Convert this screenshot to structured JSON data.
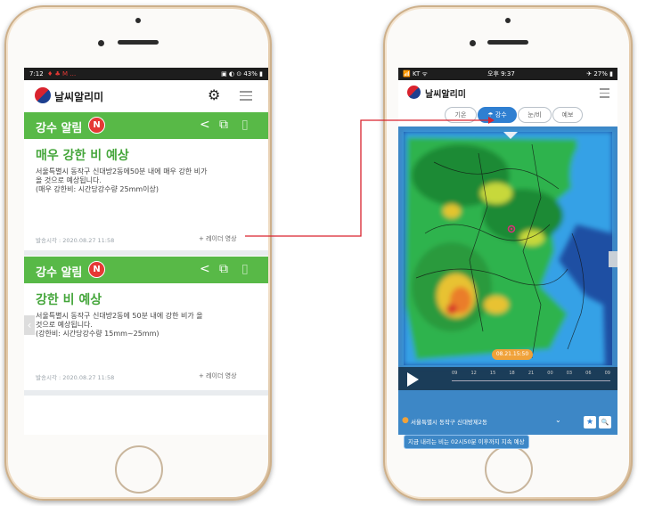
{
  "left_phone": {
    "status": {
      "time": "7:12",
      "icons": "♦ ♣ M …",
      "right": "▣ ◐ ⊙ 43% ▮"
    },
    "header": {
      "app_name": "날씨알리미",
      "gear_icon": "gear-icon",
      "menu_icon": "menu-icon"
    },
    "cards": [
      {
        "tag": "강수 알림",
        "badge": "N",
        "headline": "매우 강한 비 예상",
        "body": [
          "서울특별시 동작구 신대방2동에50분 내에 매우 강한 비가",
          "올 것으로 예상됩니다.",
          "(매우 강한비: 시간당강수량 25mm이상)"
        ],
        "time": "발송시각 : 2020.08.27 11:58",
        "link": "+ 레이더 영상"
      },
      {
        "tag": "강수 알림",
        "badge": "N",
        "headline": "강한 비 예상",
        "body": [
          "서울특별시 동작구 신대방2동에 50분 내에 강한 비가 올",
          "것으로 예상됩니다.",
          "(강한비: 시간당강수량 15mm~25mm)"
        ],
        "time": "발송시각 : 2020.08.27 11:58",
        "link": "+ 레이더 영상"
      }
    ]
  },
  "right_phone": {
    "status": {
      "carrier": "📶 KT ᯤ",
      "time": "오후 9:37",
      "battery": "✈ 27% ▮"
    },
    "header": {
      "app_name": "날씨알리미"
    },
    "tabs": [
      {
        "label": "기온",
        "active": false
      },
      {
        "label": "☂ 강수",
        "active": true
      },
      {
        "label": "눈/비",
        "active": false
      },
      {
        "label": "예보",
        "active": false
      }
    ],
    "radar": {
      "timestamp": "08.21.15:50",
      "ticks": [
        "09",
        "12",
        "15",
        "18",
        "21",
        "00",
        "03",
        "06",
        "09"
      ]
    },
    "location": {
      "text": "서울특별시 동작구 신대방제2동",
      "star_label": "★",
      "search_label": "🔍"
    },
    "notice": "지금 내리는 비는 02시50분 이후까지 지속 예상"
  },
  "colors": {
    "green": "#58b947",
    "headline_green": "#45a63b",
    "badge_red": "#e53935",
    "tab_blue": "#2f7fd1",
    "connector_red": "#d9232e"
  }
}
